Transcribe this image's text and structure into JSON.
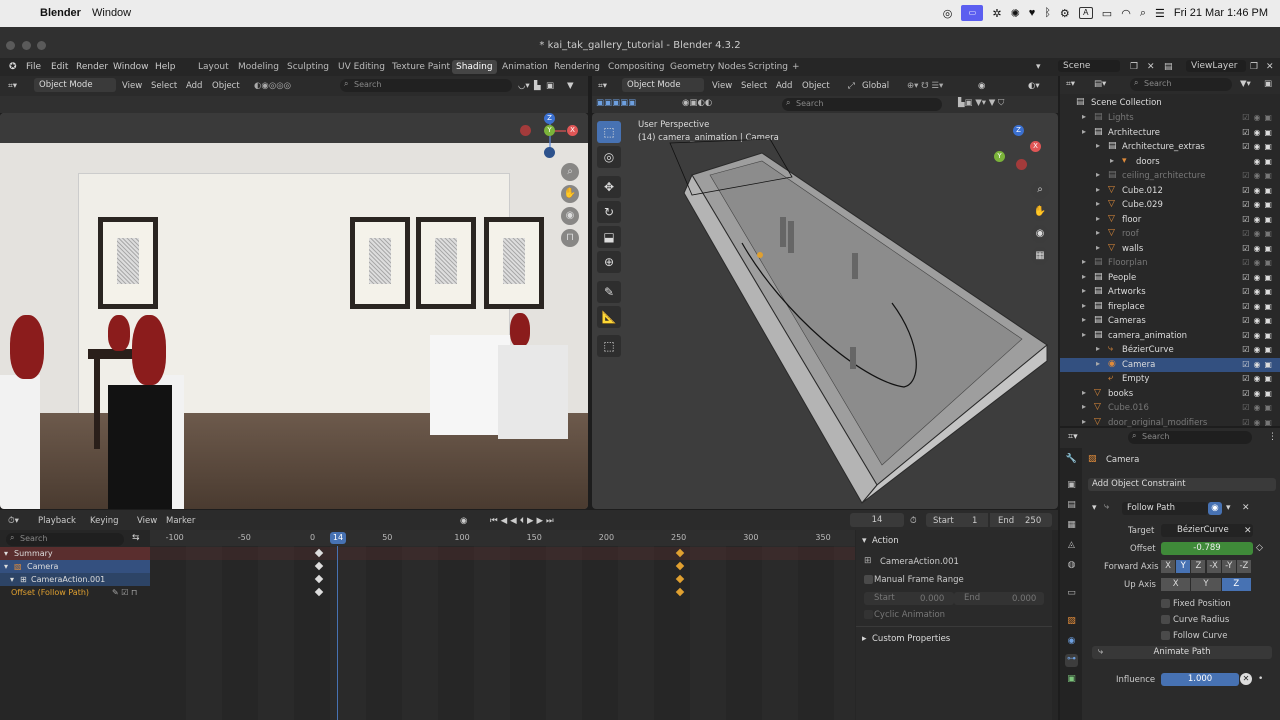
{
  "mac_menubar": {
    "app": "Blender",
    "menu": "Window",
    "datetime": "Fri 21 Mar  1:46 PM",
    "input_indicator": "A"
  },
  "window": {
    "title": "* kai_tak_gallery_tutorial - Blender 4.3.2"
  },
  "menu": {
    "items": [
      "File",
      "Edit",
      "Render",
      "Window",
      "Help"
    ],
    "workspaces": [
      "Layout",
      "Modeling",
      "Sculpting",
      "UV Editing",
      "Texture Paint",
      "Shading",
      "Animation",
      "Rendering",
      "Compositing",
      "Geometry Nodes",
      "Scripting"
    ],
    "active_workspace": "Shading",
    "add_tab": "+",
    "scene": "Scene",
    "view_layer": "ViewLayer"
  },
  "viewport_left": {
    "mode": "Object Mode",
    "menus": [
      "View",
      "Select",
      "Add",
      "Object"
    ],
    "search_placeholder": "Search"
  },
  "viewport_right": {
    "mode": "Object Mode",
    "menus": [
      "View",
      "Select",
      "Add",
      "Object"
    ],
    "orientation": "Global",
    "search_placeholder": "Search",
    "overlay_line1": "User Perspective",
    "overlay_line2": "(14) camera_animation | Camera"
  },
  "outliner": {
    "search_placeholder": "Search",
    "root": "Scene Collection",
    "rows": [
      {
        "name": "Lights",
        "dim": true,
        "indent": 0
      },
      {
        "name": "Architecture",
        "dim": false,
        "indent": 0
      },
      {
        "name": "Architecture_extras",
        "dim": false,
        "indent": 1
      },
      {
        "name": "doors",
        "dim": false,
        "indent": 2
      },
      {
        "name": "ceiling_architecture",
        "dim": true,
        "indent": 1
      },
      {
        "name": "Cube.012",
        "dim": false,
        "indent": 1
      },
      {
        "name": "Cube.029",
        "dim": false,
        "indent": 1
      },
      {
        "name": "floor",
        "dim": false,
        "indent": 1
      },
      {
        "name": "roof",
        "dim": true,
        "indent": 1
      },
      {
        "name": "walls",
        "dim": false,
        "indent": 1
      },
      {
        "name": "Floorplan",
        "dim": true,
        "indent": 0
      },
      {
        "name": "People",
        "dim": false,
        "indent": 0
      },
      {
        "name": "Artworks",
        "dim": false,
        "indent": 0
      },
      {
        "name": "fireplace",
        "dim": false,
        "indent": 0
      },
      {
        "name": "Cameras",
        "dim": false,
        "indent": 0
      },
      {
        "name": "camera_animation",
        "dim": false,
        "indent": 0
      },
      {
        "name": "BézierCurve",
        "dim": false,
        "indent": 1
      },
      {
        "name": "Camera",
        "dim": false,
        "indent": 1,
        "selected": true
      },
      {
        "name": "Empty",
        "dim": false,
        "indent": 1
      },
      {
        "name": "books",
        "dim": false,
        "indent": 0
      },
      {
        "name": "Cube.016",
        "dim": true,
        "indent": 0
      },
      {
        "name": "door_original_modifiers",
        "dim": true,
        "indent": 0
      }
    ]
  },
  "properties": {
    "search_placeholder": "Search",
    "object_name": "Camera",
    "add_constraint": "Add Object Constraint",
    "constraint_name": "Follow Path",
    "target_label": "Target",
    "target_value": "BézierCurve",
    "offset_label": "Offset",
    "offset_value": "-0.789",
    "forward_label": "Forward Axis",
    "forward_axes": [
      "X",
      "Y",
      "Z",
      "-X",
      "-Y",
      "-Z"
    ],
    "forward_active": "Y",
    "up_label": "Up Axis",
    "up_axes": [
      "X",
      "Y",
      "Z"
    ],
    "up_active": "Z",
    "fixed_position": "Fixed Position",
    "curve_radius": "Curve Radius",
    "follow_curve": "Follow Curve",
    "animate_path": "Animate Path",
    "influence_label": "Influence",
    "influence_value": "1.000"
  },
  "timeline": {
    "menus": [
      "Playback",
      "Keying",
      "View",
      "Marker"
    ],
    "current_frame": "14",
    "start_label": "Start",
    "start_value": "1",
    "end_label": "End",
    "end_value": "250",
    "ruler": [
      "-100",
      "-50",
      "0",
      "14",
      "50",
      "100",
      "150",
      "200",
      "250",
      "300",
      "350"
    ],
    "search_placeholder": "Search",
    "channels": [
      "Summary",
      "Camera",
      "CameraAction.001",
      "Offset (Follow Path)"
    ]
  },
  "action_panel": {
    "header": "Action",
    "action_name": "CameraAction.001",
    "manual_frame_range": "Manual Frame Range",
    "start_label": "Start",
    "start_value": "0.000",
    "end_label": "End",
    "end_value": "0.000",
    "cyclic": "Cyclic Animation",
    "custom_props": "Custom Properties"
  },
  "colors": {
    "accent": "#4772b3",
    "selected_row": "#335080",
    "keyframe": "#e0a030",
    "object_icon": "#e08b3a"
  }
}
